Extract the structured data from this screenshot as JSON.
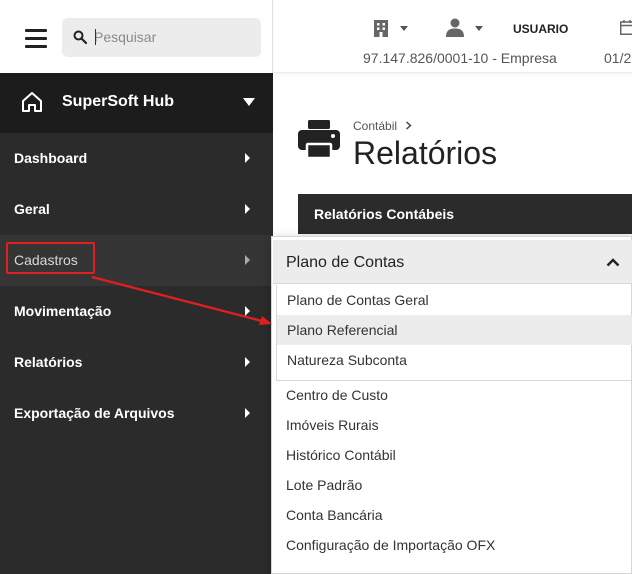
{
  "search": {
    "placeholder": "Pesquisar"
  },
  "sidebar": {
    "brand": "SuperSoft Hub",
    "items": [
      {
        "label": "Dashboard"
      },
      {
        "label": "Geral"
      },
      {
        "label": "Cadastros"
      },
      {
        "label": "Movimentação"
      },
      {
        "label": "Relatórios"
      },
      {
        "label": "Exportação de Arquivos"
      }
    ]
  },
  "topbar": {
    "user": "USUARIO",
    "company": "97.147.826/0001-10 - Empresa",
    "date": "01/2"
  },
  "main": {
    "breadcrumb": "Contábil",
    "title": "Relatórios",
    "section": "Relatórios Contábeis"
  },
  "dropdown": {
    "header": "Plano de Contas",
    "subitems": [
      {
        "label": "Plano de Contas Geral"
      },
      {
        "label": "Plano Referencial"
      },
      {
        "label": "Natureza Subconta"
      }
    ],
    "items": [
      {
        "label": "Centro de Custo"
      },
      {
        "label": "Imóveis Rurais"
      },
      {
        "label": "Histórico Contábil"
      },
      {
        "label": "Lote Padrão"
      },
      {
        "label": "Conta Bancária"
      },
      {
        "label": "Configuração de Importação OFX"
      }
    ]
  },
  "colors": {
    "sidebar_bg": "#2b2b2b",
    "brand_bg": "#1c1c1c",
    "annotation": "#e02020"
  },
  "icons": [
    "menu-icon",
    "search-icon",
    "home-icon",
    "building-icon",
    "user-icon",
    "calendar-icon",
    "printer-icon",
    "chevron-up-icon"
  ]
}
